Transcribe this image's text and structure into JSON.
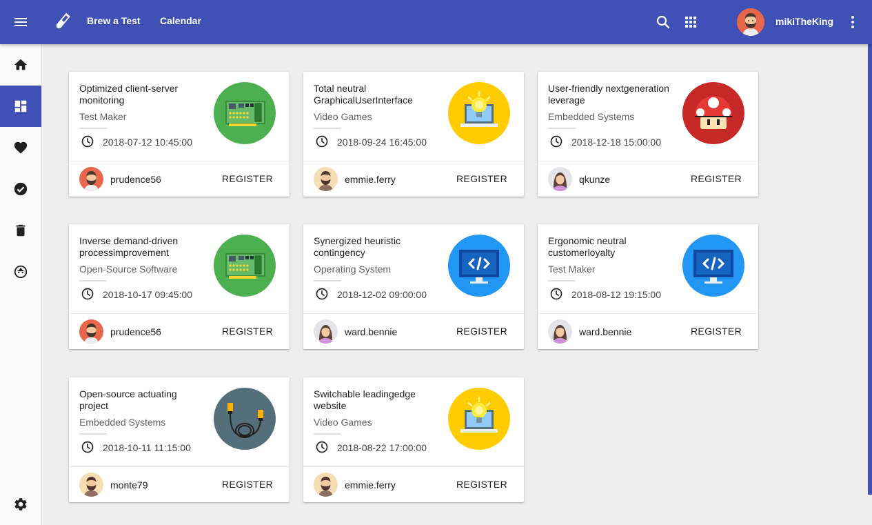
{
  "header": {
    "brand_icon": "test-tube-icon",
    "nav": [
      "Brew a Test",
      "Calendar"
    ],
    "username": "mikiTheKing",
    "accent": "#3f51b5"
  },
  "sidebar": {
    "items": [
      "home-icon",
      "dashboard-icon",
      "heart-icon",
      "check-circle-icon",
      "trash-icon",
      "face-icon"
    ],
    "active": "dashboard-icon",
    "footer": "gear-icon"
  },
  "cards": [
    {
      "title": "Optimized client-server monitoring",
      "category": "Test Maker",
      "date": "2018-07-12 10:45:00",
      "image": "circuit-board",
      "user": "prudence56",
      "action": "REGISTER"
    },
    {
      "title": "Total neutral GraphicalUserInterface",
      "category": "Video Games",
      "date": "2018-09-24 16:45:00",
      "image": "lightbulb-laptop",
      "user": "emmie.ferry",
      "action": "REGISTER"
    },
    {
      "title": "User-friendly nextgeneration leverage",
      "category": "Embedded Systems",
      "date": "2018-12-18 15:00:00",
      "image": "mushroom",
      "user": "qkunze",
      "action": "REGISTER"
    },
    {
      "title": "Inverse demand-driven processimprovement",
      "category": "Open-Source Software",
      "date": "2018-10-17 09:45:00",
      "image": "circuit-board",
      "user": "prudence56",
      "action": "REGISTER"
    },
    {
      "title": "Synergized heuristic contingency",
      "category": "Operating System",
      "date": "2018-12-02 09:00:00",
      "image": "code-monitor",
      "user": "ward.bennie",
      "action": "REGISTER"
    },
    {
      "title": "Ergonomic neutral customerloyalty",
      "category": "Test Maker",
      "date": "2018-08-12 19:15:00",
      "image": "code-monitor",
      "user": "ward.bennie",
      "action": "REGISTER"
    },
    {
      "title": "Open-source actuating project",
      "category": "Embedded Systems",
      "date": "2018-10-11 11:15:00",
      "image": "cable",
      "user": "monte79",
      "action": "REGISTER"
    },
    {
      "title": "Switchable leadingedge website",
      "category": "Video Games",
      "date": "2018-08-22 17:00:00",
      "image": "lightbulb-laptop",
      "user": "emmie.ferry",
      "action": "REGISTER"
    }
  ]
}
